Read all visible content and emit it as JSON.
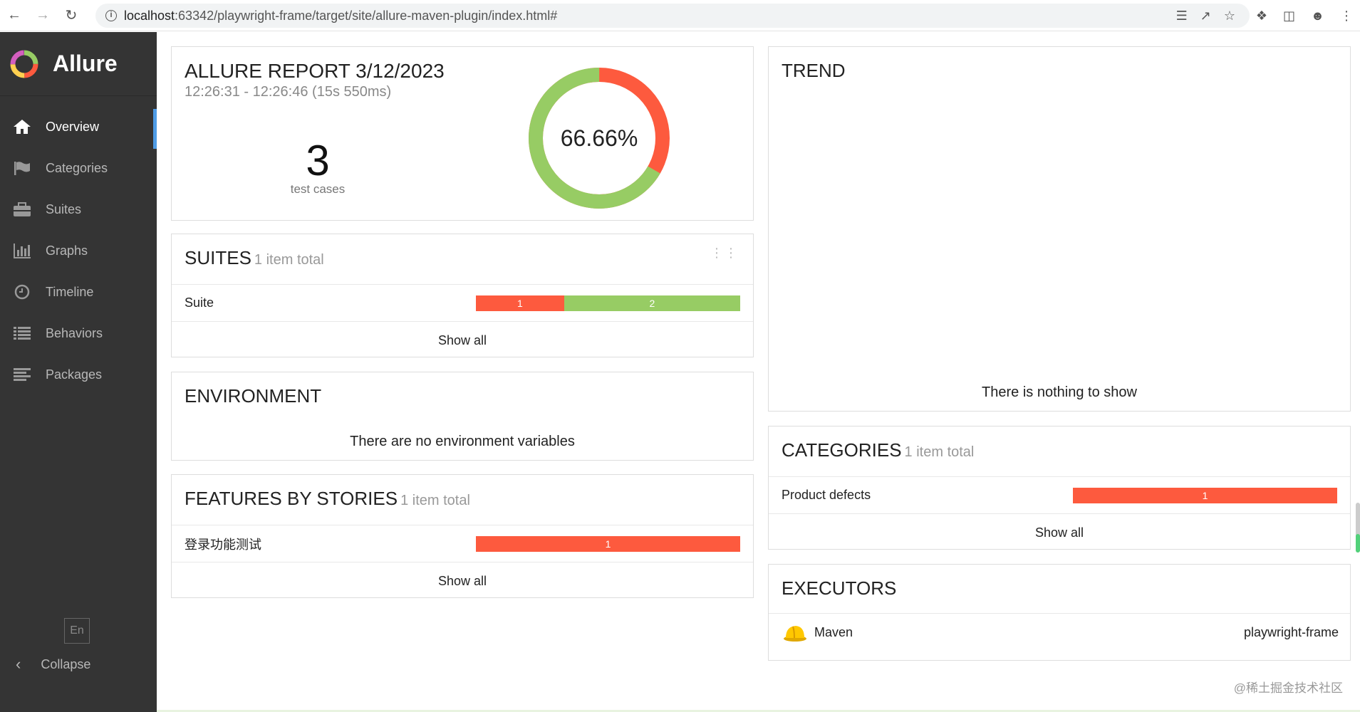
{
  "browser": {
    "url_host": "localhost",
    "url_path": ":63342/playwright-frame/target/site/allure-maven-plugin/index.html#"
  },
  "sidebar": {
    "brand": "Allure",
    "items": [
      {
        "label": "Overview",
        "icon": "home-icon",
        "active": true
      },
      {
        "label": "Categories",
        "icon": "flag-icon",
        "active": false
      },
      {
        "label": "Suites",
        "icon": "briefcase-icon",
        "active": false
      },
      {
        "label": "Graphs",
        "icon": "bar-chart-icon",
        "active": false
      },
      {
        "label": "Timeline",
        "icon": "clock-icon",
        "active": false
      },
      {
        "label": "Behaviors",
        "icon": "list-icon",
        "active": false
      },
      {
        "label": "Packages",
        "icon": "align-left-icon",
        "active": false
      }
    ],
    "lang": "En",
    "collapse": "Collapse"
  },
  "report": {
    "title": "ALLURE REPORT 3/12/2023",
    "time": "12:26:31 - 12:26:46 (15s 550ms)",
    "count": "3",
    "count_label": "test cases",
    "percent": "66.66%",
    "passed_fraction": 0.6666
  },
  "suites": {
    "title": "SUITES",
    "count": "1 item total",
    "rows": [
      {
        "name": "Suite",
        "failed": "1",
        "passed": "2"
      }
    ],
    "show_all": "Show all"
  },
  "environment": {
    "title": "ENVIRONMENT",
    "empty": "There are no environment variables"
  },
  "features": {
    "title": "FEATURES BY STORIES",
    "count": "1 item total",
    "rows": [
      {
        "name": "登录功能测试",
        "failed": "1"
      }
    ],
    "show_all": "Show all"
  },
  "trend": {
    "title": "TREND",
    "empty": "There is nothing to show"
  },
  "categories": {
    "title": "CATEGORIES",
    "count": "1 item total",
    "rows": [
      {
        "name": "Product defects",
        "failed": "1"
      }
    ],
    "show_all": "Show all"
  },
  "executors": {
    "title": "EXECUTORS",
    "name": "Maven",
    "build": "playwright-frame"
  },
  "watermark": "@稀土掘金技术社区",
  "colors": {
    "failed": "#fd5a3e",
    "passed": "#97cc64",
    "sidebar": "#343434",
    "accent": "#4e9ce6"
  }
}
